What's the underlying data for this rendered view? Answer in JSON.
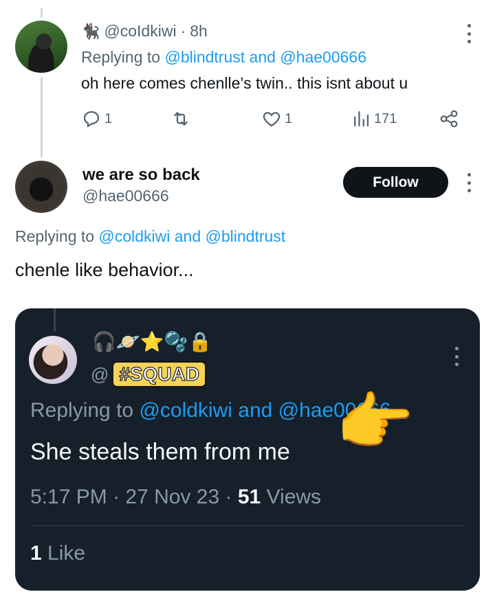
{
  "reply_tweet": {
    "handle": "@coIdkiwi",
    "separator": "·",
    "time": "8h",
    "replying_prefix": "Replying to",
    "replying_user1": "@blindtrust",
    "replying_and": "and",
    "replying_user2": "@hae00666",
    "text": "oh here comes chenlle’s twin.. this isnt about u",
    "reply_count": "1",
    "like_count": "1",
    "views_count": "171"
  },
  "main_tweet": {
    "display_name": "we are so back",
    "handle": "@hae00666",
    "follow_label": "Follow",
    "replying_prefix": "Replying to",
    "replying_user1": "@coldkiwi",
    "replying_and": "and",
    "replying_user2": "@blindtrust",
    "text": "chenle like behavior..."
  },
  "quoted_card": {
    "emoji_row": "🎧🪐⭐🫧🔒",
    "handle_at": "@",
    "squad_label": "#SQUAD",
    "replying_prefix": "Replying to",
    "replying_user1": "@coldkiwi",
    "replying_and": "and",
    "replying_user2": "@hae00666",
    "text": "She steals them from me",
    "pointing_emoji": "👉",
    "time": "5:17 PM",
    "date": "27 Nov 23",
    "views_count": "51",
    "views_label": "Views",
    "likes_count": "1",
    "likes_label": "Like"
  },
  "colors": {
    "accent": "#1d9bf0",
    "muted": "#536471",
    "dark_card": "#15202b"
  }
}
